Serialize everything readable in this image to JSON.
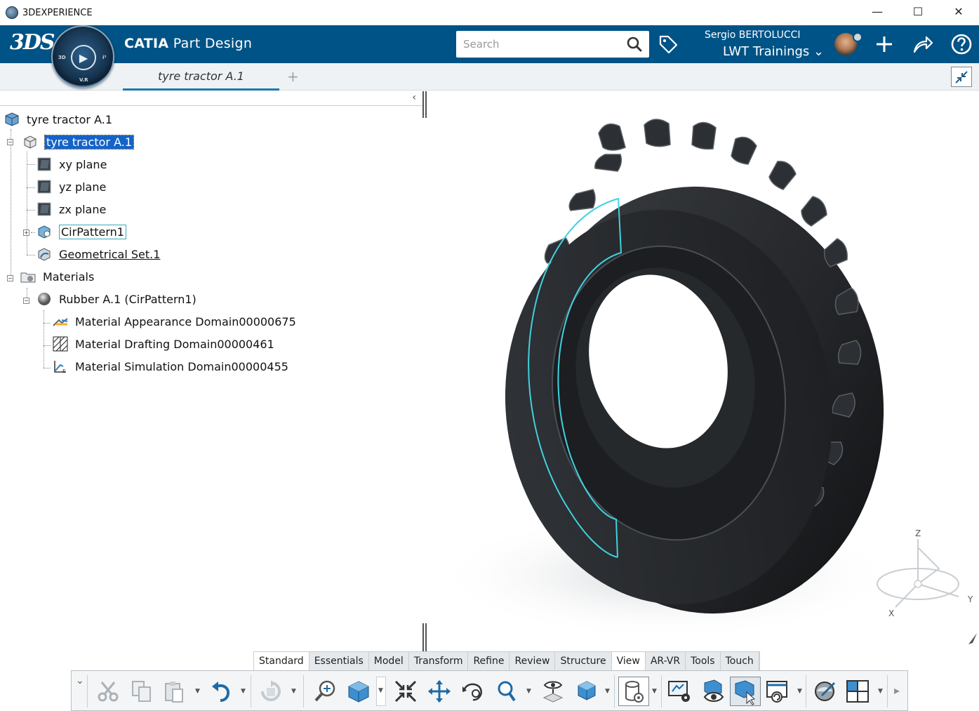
{
  "window": {
    "title": "3DEXPERIENCE",
    "minimize": "—",
    "maximize": "☐",
    "close": "✕"
  },
  "header": {
    "logo": "3DS",
    "app_brand": "CATIA",
    "app_module": "Part Design",
    "search_placeholder": "Search",
    "user_name": "Sergio BERTOLUCCI",
    "team_name": "LWT Trainings",
    "compass_labels": [
      "3D",
      "V.R",
      "i³"
    ]
  },
  "tabs": {
    "active_tab": "tyre tractor A.1",
    "add_tab": "+"
  },
  "tree": {
    "toggle": "‹",
    "nodes": [
      {
        "label": "tyre tractor A.1"
      },
      {
        "label": "tyre tractor A.1"
      },
      {
        "label": "xy plane"
      },
      {
        "label": "yz plane"
      },
      {
        "label": "zx plane"
      },
      {
        "label": "CirPattern1"
      },
      {
        "label": "Geometrical Set.1"
      },
      {
        "label": "Materials"
      },
      {
        "label": "Rubber A.1 (CirPattern1)"
      },
      {
        "label": "Material Appearance Domain00000675"
      },
      {
        "label": "Material Drafting Domain00000461"
      },
      {
        "label": "Material Simulation Domain00000455"
      }
    ]
  },
  "compass_axes": {
    "x": "X",
    "y": "Y",
    "z": "Z"
  },
  "action_bar": {
    "tabs": [
      "Standard",
      "Essentials",
      "Model",
      "Transform",
      "Refine",
      "Review",
      "Structure",
      "View",
      "AR-VR",
      "Tools",
      "Touch"
    ],
    "active": "View",
    "expand_glyph": "⌄",
    "more_glyph": "▸"
  },
  "colors": {
    "header_blue": "#005386",
    "selection_blue": "#1464c8",
    "highlight_cyan": "#3fd2df",
    "tyre_dark": "#2a2c2f"
  }
}
